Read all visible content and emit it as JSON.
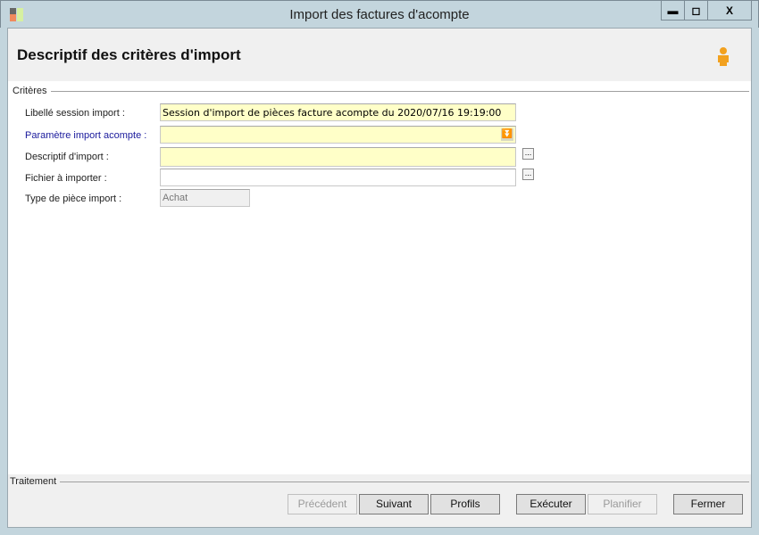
{
  "window": {
    "title": "Import des factures d'acompte",
    "minimize": "▬",
    "maximize": "◻",
    "close": "X"
  },
  "header": {
    "title": "Descriptif des critères d'import"
  },
  "criteria": {
    "group_label": "Critères",
    "fields": [
      {
        "label": "Libellé session import :",
        "value": "Session d'import de pièces facture acompte du 2020/07/16 19:19:00"
      },
      {
        "label": "Paramètre import acompte :",
        "value": ""
      },
      {
        "label": "Descriptif d'import :",
        "value": ""
      },
      {
        "label": "Fichier à importer :",
        "value": ""
      },
      {
        "label": "Type de pièce import :",
        "value": "Achat"
      }
    ],
    "ellipsis": "..."
  },
  "footer": {
    "group_label": "Traitement",
    "buttons": {
      "previous": "Précédent",
      "next": "Suivant",
      "profiles": "Profils",
      "execute": "Exécuter",
      "schedule": "Planifier",
      "close": "Fermer"
    }
  }
}
